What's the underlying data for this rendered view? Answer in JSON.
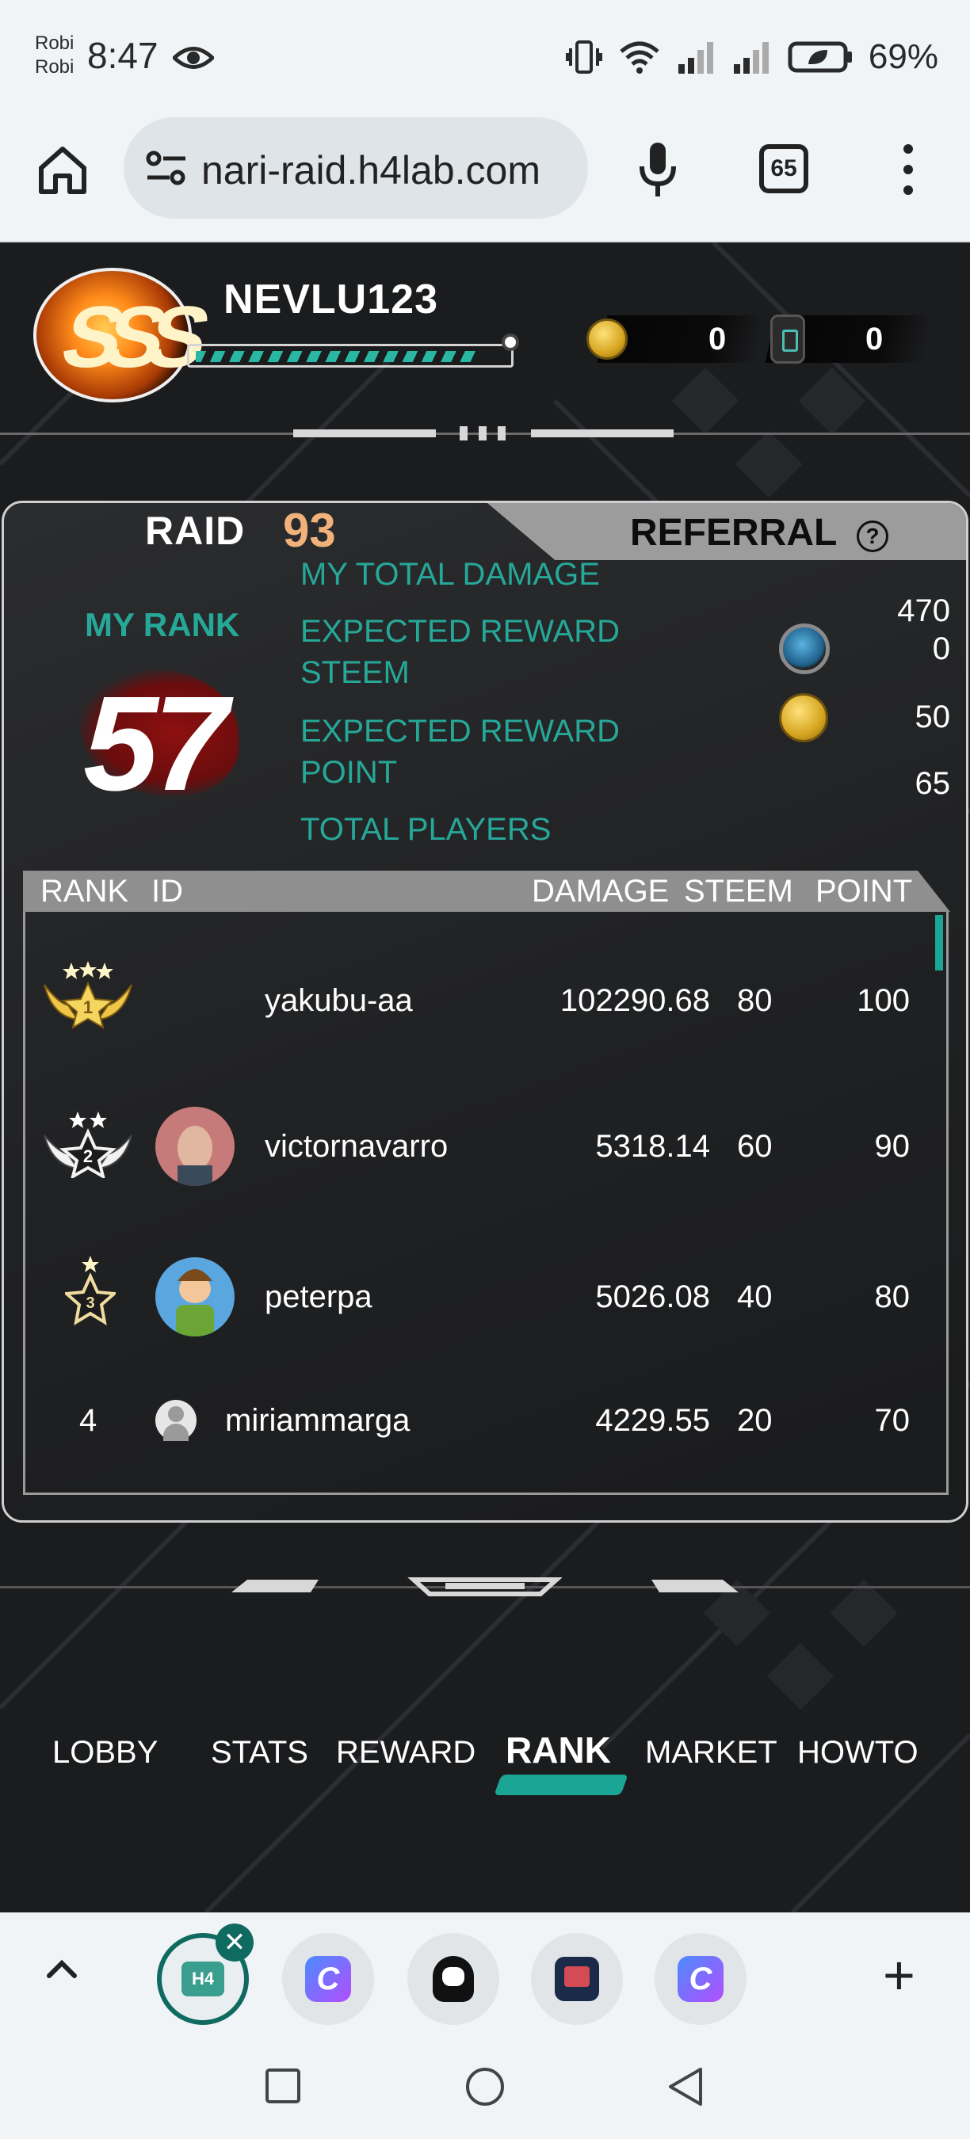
{
  "status": {
    "carrier_line1": "Robi",
    "carrier_line2": "Robi",
    "time": "8:47",
    "battery": "69%"
  },
  "browser": {
    "url": "nari-raid.h4lab.com",
    "tab_count": "65"
  },
  "player": {
    "name": "NEVLU123",
    "xp_fraction": 0.93,
    "coins": "0",
    "tickets": "0"
  },
  "tabs": {
    "raid_label": "RAID",
    "raid_number": "93",
    "referral_label": "REFERRAL",
    "help": "?"
  },
  "my_rank": {
    "label": "MY RANK",
    "value": "57"
  },
  "stats": {
    "total_damage_label": "MY TOTAL DAMAGE",
    "total_damage_value": "470",
    "reward_steem_label_1": "EXPECTED REWARD",
    "reward_steem_label_2": "STEEM",
    "reward_steem_value": "0",
    "reward_point_label_1": "EXPECTED REWARD",
    "reward_point_label_2": "POINT",
    "reward_point_value": "50",
    "total_players_label": "TOTAL PLAYERS",
    "total_players_value": "65"
  },
  "table": {
    "headers": {
      "rank": "RANK",
      "id": "ID",
      "damage": "DAMAGE",
      "steem": "STEEM",
      "point": "POINT"
    },
    "rows": [
      {
        "rank": "1",
        "id": "yakubu-aa",
        "damage": "102290.68",
        "steem": "80",
        "point": "100"
      },
      {
        "rank": "2",
        "id": "victornavarro",
        "damage": "5318.14",
        "steem": "60",
        "point": "90"
      },
      {
        "rank": "3",
        "id": "peterpa",
        "damage": "5026.08",
        "steem": "40",
        "point": "80"
      },
      {
        "rank": "4",
        "id": "miriammarga",
        "damage": "4229.55",
        "steem": "20",
        "point": "70"
      }
    ]
  },
  "nav": {
    "items": [
      "LOBBY",
      "STATS",
      "REWARD",
      "RANK",
      "MARKET",
      "HOWTO"
    ],
    "active": "RANK"
  },
  "tabstrip": {
    "active_tab_label": "H4",
    "app_c_label": "C",
    "close": "✕",
    "add": "+"
  },
  "colors": {
    "accent_teal": "#26a898",
    "raid_number": "#f0b27a",
    "background": "#1b1c1e"
  }
}
